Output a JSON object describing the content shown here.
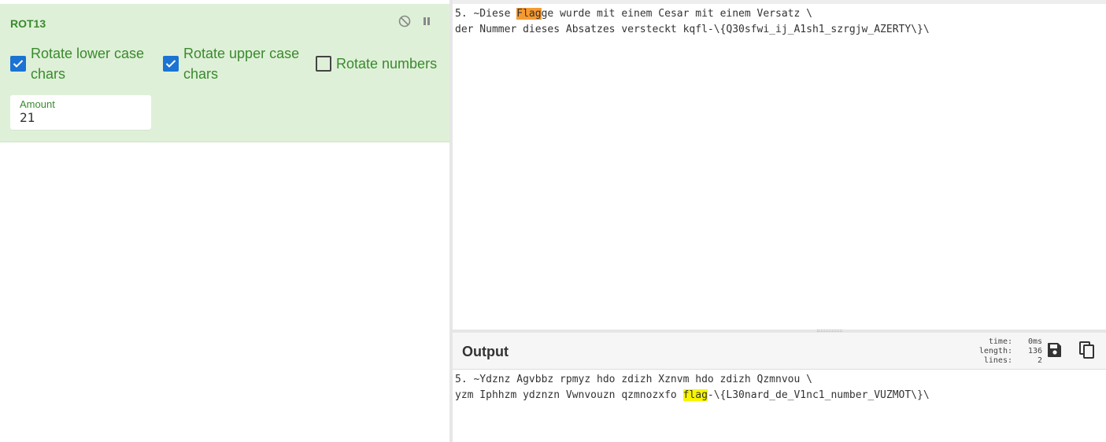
{
  "recipe": {
    "operation": {
      "title": "ROT13",
      "options": {
        "rotate_lower": {
          "label_line1": "Rotate lower case",
          "label_line2": "chars",
          "checked": true
        },
        "rotate_upper": {
          "label_line1": "Rotate upper case",
          "label_line2": "chars",
          "checked": true
        },
        "rotate_numbers": {
          "label": "Rotate numbers",
          "checked": false
        }
      },
      "amount": {
        "label": "Amount",
        "value": "21"
      },
      "controls": {
        "disable_icon": "disable-icon",
        "pause_icon": "pause-icon"
      }
    }
  },
  "input": {
    "line1": {
      "before": "5. ~Diese ",
      "highlight": "Flag",
      "after": "ge wurde mit einem Cesar mit einem Versatz \\"
    },
    "line2": "der Nummer dieses Absatzes versteckt kqfl-\\{Q30sfwi_ij_A1sh1_szrgjw_AZERTY\\}\\"
  },
  "output": {
    "title": "Output",
    "stats": {
      "time_label": "time:",
      "time_value": "0ms",
      "length_label": "length:",
      "length_value": "136",
      "lines_label": "lines:",
      "lines_value": "2"
    },
    "buttons": {
      "save_icon": "save-icon",
      "copy_icon": "copy-icon"
    },
    "line1": "5. ~Ydznz Agvbbz rpmyz hdo zdizh Xznvm hdo zdizh Qzmnvou \\",
    "line2": {
      "before": "yzm Iphhzm ydznzn Vwnvouzn qzmnozxfo ",
      "highlight": "flag",
      "after": "-\\{L30nard_de_V1nc1_number_VUZMOT\\}\\"
    }
  },
  "colors": {
    "operation_bg": "#dff0d8",
    "operation_text": "#3a8a2e",
    "checkbox_checked": "#1b73d3",
    "input_highlight": "#f79a2e",
    "output_highlight": "#f7f500"
  }
}
